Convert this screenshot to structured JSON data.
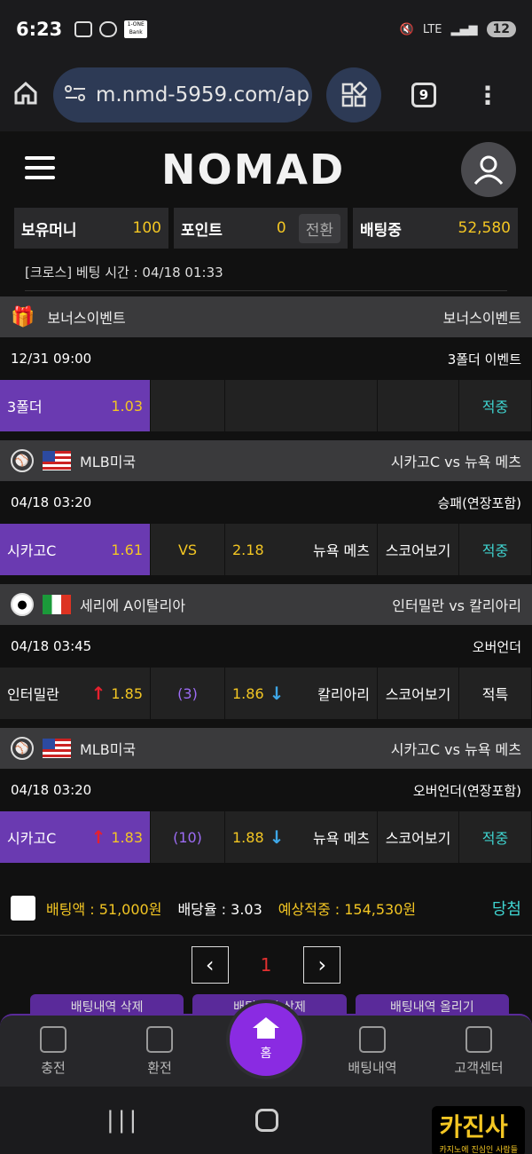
{
  "status": {
    "time": "6:23",
    "net": "LTE",
    "battery": "12",
    "box_label": "1-ONE Bank"
  },
  "browser": {
    "url": "m.nmd-5959.com/ap",
    "tab_count": "9"
  },
  "site": {
    "logo": "NOMAD"
  },
  "money": {
    "hold_label": "보유머니",
    "hold_value": "100",
    "point_label": "포인트",
    "point_value": "0",
    "convert_label": "전환",
    "betting_label": "배팅중",
    "betting_value": "52,580"
  },
  "cross_info": "[크로스] 베팅 시간 : 04/18 01:33",
  "games": [
    {
      "league": "보너스이벤트",
      "title_right": "보너스이벤트",
      "time": "12/31 09:00",
      "type": "3폴더 이벤트",
      "home": "3폴더",
      "home_odds": "1.03",
      "mid": "",
      "away_odds": "",
      "away": "",
      "score_label": "",
      "result": "적중"
    },
    {
      "league": "MLB미국",
      "title_right": "시카고C vs 뉴욕 메츠",
      "time": "04/18 03:20",
      "type": "승패(연장포함)",
      "home": "시카고C",
      "home_odds": "1.61",
      "mid": "VS",
      "away_odds": "2.18",
      "away": "뉴욕 메츠",
      "score_label": "스코어보기",
      "result": "적중"
    },
    {
      "league": "세리에 A이탈리아",
      "title_right": "인터밀란 vs 칼리아리",
      "time": "04/18 03:45",
      "type": "오버언더",
      "home": "인터밀란",
      "home_odds": "1.85",
      "mid": "(3)",
      "away_odds": "1.86",
      "away": "칼리아리",
      "score_label": "스코어보기",
      "result": "적특"
    },
    {
      "league": "MLB미국",
      "title_right": "시카고C vs 뉴욕 메츠",
      "time": "04/18 03:20",
      "type": "오버언더(연장포함)",
      "home": "시카고C",
      "home_odds": "1.83",
      "mid": "(10)",
      "away_odds": "1.88",
      "away": "뉴욕 메츠",
      "score_label": "스코어보기",
      "result": "적중"
    }
  ],
  "bet_summary": {
    "amount": "배팅액 : 51,000원",
    "rate": "배당율 : 3.03",
    "expected": "예상적중 : 154,530원",
    "result": "당첨"
  },
  "pager": {
    "page": "1"
  },
  "action_buttons": [
    "배팅내역 삭제",
    "배팅내역 삭제",
    "배팅내역 올리기"
  ],
  "bottom_nav": {
    "charge": "충전",
    "withdraw": "환전",
    "home": "홈",
    "history": "배팅내역",
    "support": "고객센터"
  },
  "watermark": {
    "main": "카진사",
    "sub": "카지노에 진심인 사람들"
  },
  "colors": {
    "accent_purple": "#6a3ab1",
    "odds_gold": "#f3c623",
    "result_teal": "#3fd3cf",
    "up_red": "#e8202e",
    "down_blue": "#3ea8e8"
  }
}
